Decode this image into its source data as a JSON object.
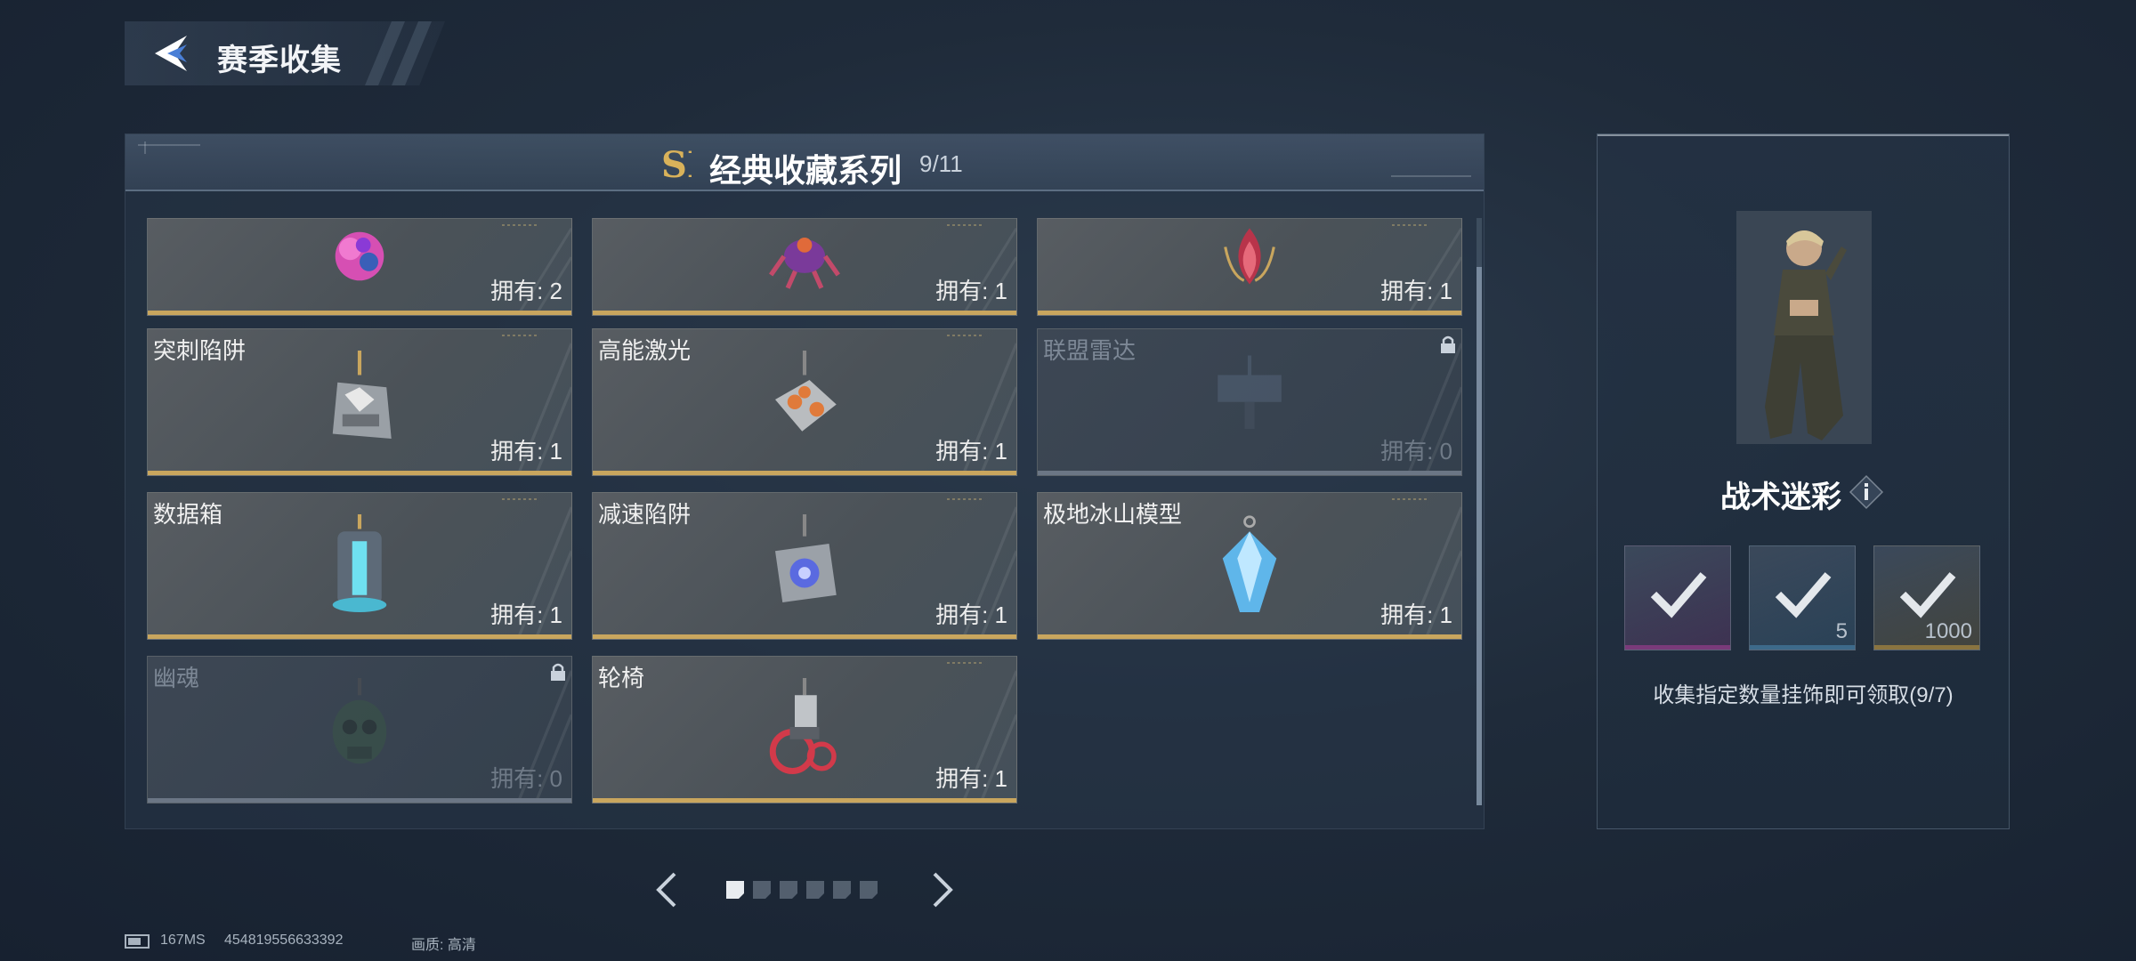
{
  "header": {
    "title": "赛季收集"
  },
  "series": {
    "logo_text": "SI",
    "title": "经典收藏系列",
    "count": "9/11"
  },
  "items": [
    {
      "name": "",
      "owned": "拥有: 2",
      "locked": false,
      "icon": "pink-flower-charm-icon"
    },
    {
      "name": "",
      "owned": "拥有: 1",
      "locked": false,
      "icon": "purple-scorpion-charm-icon"
    },
    {
      "name": "",
      "owned": "拥有: 1",
      "locked": false,
      "icon": "red-bloom-charm-icon"
    },
    {
      "name": "突刺陷阱",
      "owned": "拥有: 1",
      "locked": false,
      "icon": "spike-trap-charm-icon"
    },
    {
      "name": "高能激光",
      "owned": "拥有: 1",
      "locked": false,
      "icon": "laser-charm-icon"
    },
    {
      "name": "联盟雷达",
      "owned": "拥有: 0",
      "locked": true,
      "icon": "radar-charm-icon"
    },
    {
      "name": "数据箱",
      "owned": "拥有: 1",
      "locked": false,
      "icon": "data-box-charm-icon"
    },
    {
      "name": "减速陷阱",
      "owned": "拥有: 1",
      "locked": false,
      "icon": "slow-trap-charm-icon"
    },
    {
      "name": "极地冰山模型",
      "owned": "拥有: 1",
      "locked": false,
      "icon": "iceberg-charm-icon"
    },
    {
      "name": "幽魂",
      "owned": "拥有: 0",
      "locked": true,
      "icon": "ghost-skull-charm-icon"
    },
    {
      "name": "轮椅",
      "owned": "拥有: 1",
      "locked": false,
      "icon": "wheelchair-charm-icon"
    }
  ],
  "pager": {
    "total": 6,
    "current": 1
  },
  "status": {
    "ping": "167MS",
    "uid": "454819556633392",
    "quality": "画质: 高清"
  },
  "reward": {
    "skin_name": "战术迷彩",
    "items": [
      {
        "qty": "",
        "claimed": true,
        "color": "#7a3a7a"
      },
      {
        "qty": "5",
        "claimed": true,
        "color": "#3d6a8a"
      },
      {
        "qty": "1000",
        "claimed": true,
        "color": "#8a7440"
      }
    ],
    "collect_text": "收集指定数量挂饰即可领取(9/7)"
  },
  "colors": {
    "accent_gold": "#c9a65e",
    "locked_gray": "#6b7685"
  }
}
